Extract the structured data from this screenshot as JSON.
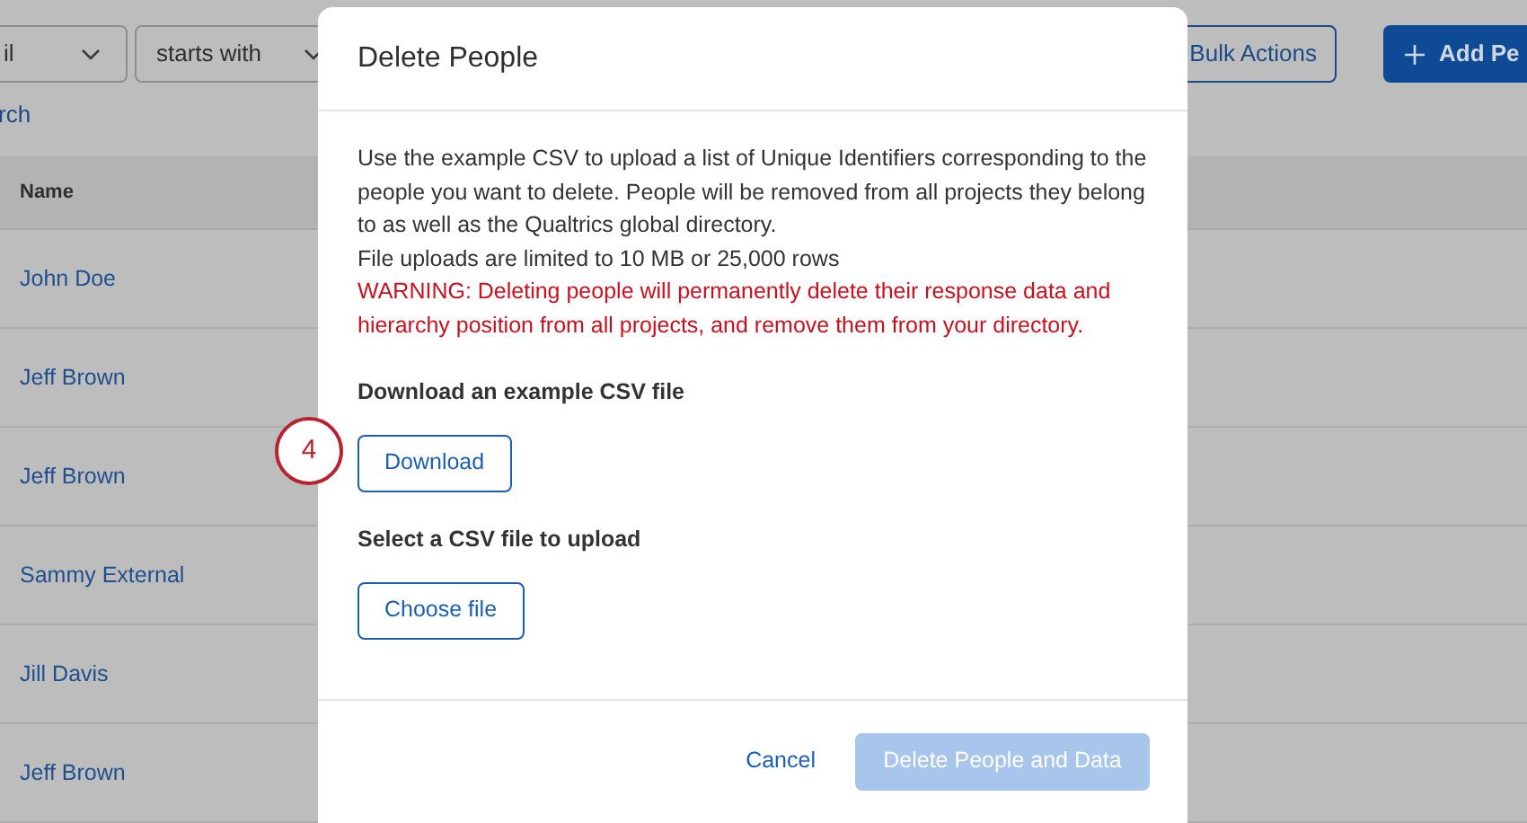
{
  "filters": [
    {
      "value": "il"
    },
    {
      "value": "starts with"
    }
  ],
  "search_link": "rch",
  "toolbar": {
    "bulk_actions": "Bulk Actions",
    "add_button": "Add Pe"
  },
  "table": {
    "columns": [
      "Name"
    ],
    "rows": [
      "John Doe",
      "Jeff Brown",
      "Jeff Brown",
      "Sammy External",
      "Jill Davis",
      "Jeff Brown"
    ]
  },
  "dialog": {
    "title": "Delete People",
    "paragraphs": [
      {
        "kind": "info",
        "text": "Use the example CSV to upload a list of Unique Identifiers corresponding to the people you want to delete. People will be removed from all projects they belong to as well as the Qualtrics global directory."
      },
      {
        "kind": "info",
        "text": "File uploads are limited to 10 MB or 25,000 rows"
      },
      {
        "kind": "warning",
        "text": "WARNING: Deleting people will permanently delete their response data and hierarchy position from all projects, and remove them from your directory."
      }
    ],
    "download_heading": "Download an example CSV file",
    "download_button": "Download",
    "upload_heading": "Select a CSV file to upload",
    "upload_button": "Choose file",
    "cancel": "Cancel",
    "confirm": {
      "label": "Delete People and Data",
      "disabled": true
    }
  },
  "step_badge": "4"
}
